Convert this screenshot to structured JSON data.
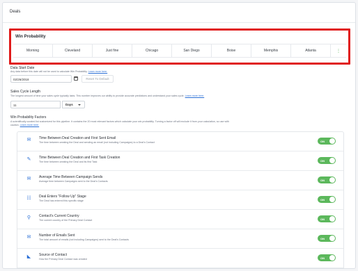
{
  "page": {
    "title": "Deals"
  },
  "win_probability": {
    "title": "Win Probability",
    "tabs": [
      "Morning",
      "Cleveland",
      "Just fine",
      "Chicago",
      "San Diego",
      "Boise",
      "Memphis",
      "Atlanta",
      "⋮"
    ],
    "highlight_color": "#e01b1b"
  },
  "data_start": {
    "label": "Data Start Date",
    "hint": "Any data before this date will not be used to calculate Win Probability.",
    "hint_link": "Learn more here.",
    "value": "02/26/2018",
    "reset_label": "Reset To Default"
  },
  "sales_cycle": {
    "label": "Sales Cycle Length",
    "hint": "The longest amount of time your sales cycle typically lasts. This number improves our ability to provide accurate predictions and understand your sales cycle.",
    "hint_link": "Learn more here.",
    "value": "11",
    "unit": "Days"
  },
  "factors_section": {
    "label": "Win Probability Factors",
    "hint_line1": "A scientifically curated list customized for this pipeline. It contains the 20 most relevant factors which calculate your win probability. Turning a factor off will exclude it from your calculation, so use with",
    "hint_line2": "caution.",
    "hint_link": "Learn more here.",
    "toggle_label": "ON",
    "items": [
      {
        "icon": "email-icon",
        "title": "Time Between Deal Creation and First Sent Email",
        "desc": "The time between creating the Deal and sending an email (not including Campaigns) to a Deal's Contact"
      },
      {
        "icon": "task-icon",
        "title": "Time Between Deal Creation and First Task Creation",
        "desc": "The time between creating the Deal and its first Task"
      },
      {
        "icon": "campaign-icon",
        "title": "Average Time Between Campaign Sends",
        "desc": "Average time between Campaigns sent to the Deal's Contacts"
      },
      {
        "icon": "stage-icon",
        "title": "Deal Enters \"Follow Up\" Stage",
        "desc": "The Deal has entered this specific stage"
      },
      {
        "icon": "location-icon",
        "title": "Contact's Current Country",
        "desc": "The current country of the Primary Deal Contact"
      },
      {
        "icon": "email-icon",
        "title": "Number of Emails Sent",
        "desc": "The total amount of emails (not including Campaigns) sent to the Deal's Contacts"
      },
      {
        "icon": "rss-icon",
        "title": "Source of Contact",
        "desc": "How the Primary Deal Contact was created"
      }
    ]
  }
}
